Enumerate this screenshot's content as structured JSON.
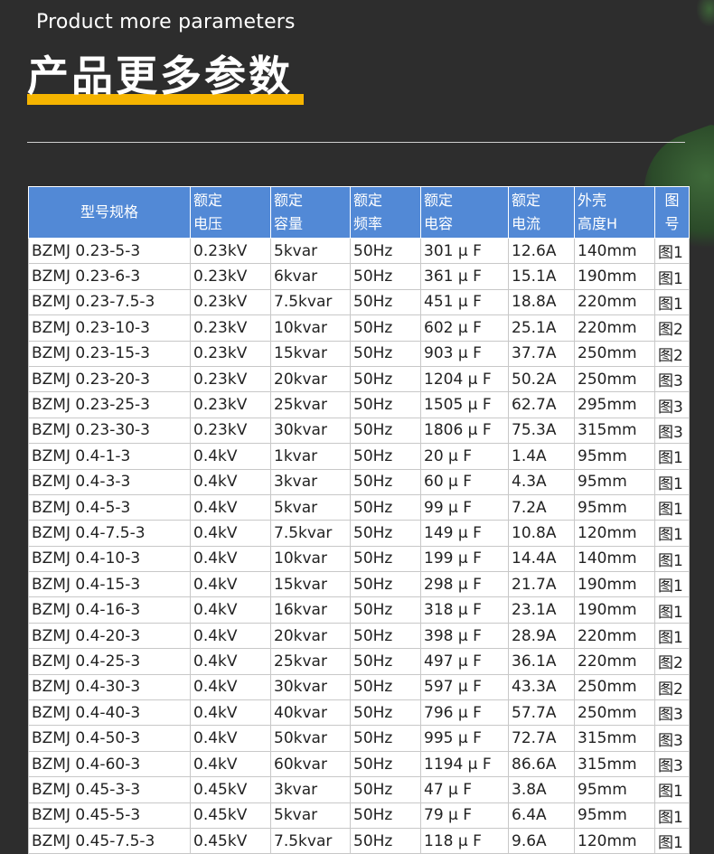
{
  "header": {
    "subtitle": "Product more parameters",
    "title": "产品更多参数"
  },
  "table": {
    "columns": [
      "型号规格",
      "额定\n电压",
      "额定\n容量",
      "额定\n频率",
      "额定\n电容",
      "额定\n电流",
      "外壳\n高度H",
      "图号"
    ],
    "rows": [
      [
        "BZMJ 0.23-5-3",
        "0.23kV",
        "5kvar",
        "50Hz",
        "301 μ F",
        "12.6A",
        "140mm",
        "图1"
      ],
      [
        "BZMJ 0.23-6-3",
        "0.23kV",
        "6kvar",
        "50Hz",
        "361 μ F",
        "15.1A",
        "190mm",
        "图1"
      ],
      [
        "BZMJ 0.23-7.5-3",
        "0.23kV",
        "7.5kvar",
        "50Hz",
        "451 μ F",
        "18.8A",
        "220mm",
        "图1"
      ],
      [
        "BZMJ 0.23-10-3",
        "0.23kV",
        "10kvar",
        "50Hz",
        "602 μ F",
        "25.1A",
        "220mm",
        "图2"
      ],
      [
        "BZMJ 0.23-15-3",
        "0.23kV",
        "15kvar",
        "50Hz",
        "903 μ F",
        "37.7A",
        "250mm",
        "图2"
      ],
      [
        "BZMJ 0.23-20-3",
        "0.23kV",
        "20kvar",
        "50Hz",
        "1204 μ F",
        "50.2A",
        "250mm",
        "图3"
      ],
      [
        "BZMJ 0.23-25-3",
        "0.23kV",
        "25kvar",
        "50Hz",
        "1505 μ F",
        "62.7A",
        "295mm",
        "图3"
      ],
      [
        "BZMJ 0.23-30-3",
        "0.23kV",
        "30kvar",
        "50Hz",
        "1806 μ F",
        "75.3A",
        "315mm",
        "图3"
      ],
      [
        "BZMJ 0.4-1-3",
        "0.4kV",
        "1kvar",
        "50Hz",
        "20 μ F",
        "1.4A",
        "95mm",
        "图1"
      ],
      [
        "BZMJ 0.4-3-3",
        "0.4kV",
        "3kvar",
        "50Hz",
        "60 μ F",
        "4.3A",
        "95mm",
        "图1"
      ],
      [
        "BZMJ 0.4-5-3",
        "0.4kV",
        "5kvar",
        "50Hz",
        "99 μ F",
        "7.2A",
        "95mm",
        "图1"
      ],
      [
        "BZMJ 0.4-7.5-3",
        "0.4kV",
        "7.5kvar",
        "50Hz",
        "149 μ F",
        "10.8A",
        "120mm",
        "图1"
      ],
      [
        "BZMJ 0.4-10-3",
        "0.4kV",
        "10kvar",
        "50Hz",
        "199 μ F",
        "14.4A",
        "140mm",
        "图1"
      ],
      [
        "BZMJ 0.4-15-3",
        "0.4kV",
        "15kvar",
        "50Hz",
        "298 μ F",
        "21.7A",
        "190mm",
        "图1"
      ],
      [
        "BZMJ 0.4-16-3",
        "0.4kV",
        "16kvar",
        "50Hz",
        "318 μ F",
        "23.1A",
        "190mm",
        "图1"
      ],
      [
        "BZMJ 0.4-20-3",
        "0.4kV",
        "20kvar",
        "50Hz",
        "398 μ F",
        "28.9A",
        "220mm",
        "图1"
      ],
      [
        "BZMJ 0.4-25-3",
        "0.4kV",
        "25kvar",
        "50Hz",
        "497 μ F",
        "36.1A",
        "220mm",
        "图2"
      ],
      [
        "BZMJ 0.4-30-3",
        "0.4kV",
        "30kvar",
        "50Hz",
        "597 μ F",
        "43.3A",
        "250mm",
        "图2"
      ],
      [
        "BZMJ 0.4-40-3",
        "0.4kV",
        "40kvar",
        "50Hz",
        "796 μ F",
        "57.7A",
        "250mm",
        "图3"
      ],
      [
        "BZMJ 0.4-50-3",
        "0.4kV",
        "50kvar",
        "50Hz",
        "995 μ F",
        "72.7A",
        "315mm",
        "图3"
      ],
      [
        "BZMJ 0.4-60-3",
        "0.4kV",
        "60kvar",
        "50Hz",
        "1194 μ F",
        "86.6A",
        "315mm",
        "图3"
      ],
      [
        "BZMJ 0.45-3-3",
        "0.45kV",
        "3kvar",
        "50Hz",
        "47 μ F",
        "3.8A",
        "95mm",
        "图1"
      ],
      [
        "BZMJ 0.45-5-3",
        "0.45kV",
        "5kvar",
        "50Hz",
        "79 μ F",
        "6.4A",
        "95mm",
        "图1"
      ],
      [
        "BZMJ 0.45-7.5-3",
        "0.45kV",
        "7.5kvar",
        "50Hz",
        "118 μ F",
        "9.6A",
        "120mm",
        "图1"
      ]
    ]
  },
  "colors": {
    "background": "#2d2d2d",
    "accent": "#f5b400",
    "header_bg": "#5289d6"
  }
}
